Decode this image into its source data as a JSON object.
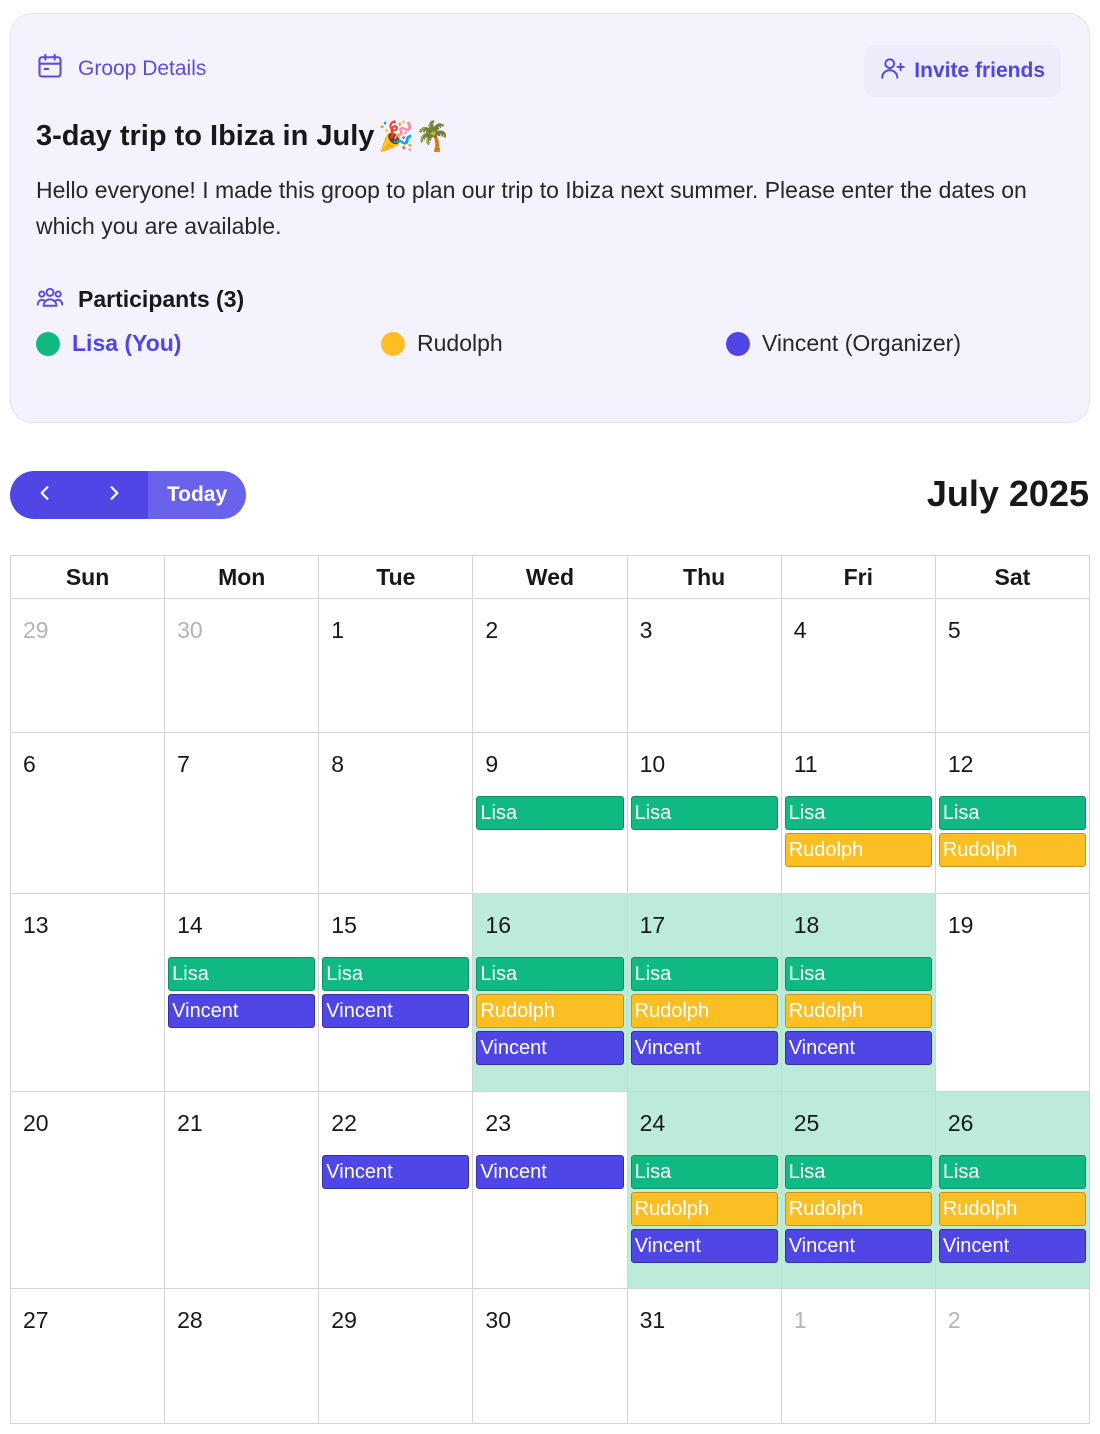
{
  "details": {
    "header_label": "Groop Details",
    "invite_label": "Invite friends",
    "title": "3-day trip to Ibiza in July",
    "title_emoji": "🎉🌴",
    "description": "Hello everyone! I made this groop to plan our trip to Ibiza next summer. Please enter the dates on which you are available.",
    "participants_label": "Participants (3)",
    "participants": [
      {
        "name": "Lisa (You)",
        "color": "#10b981"
      },
      {
        "name": "Rudolph",
        "color": "#fbbf24"
      },
      {
        "name": "Vincent (Organizer)",
        "color": "#4f46e5"
      }
    ]
  },
  "toolbar": {
    "prev_icon": "chevron-left-icon",
    "next_icon": "chevron-right-icon",
    "today_label": "Today",
    "month_title": "July 2025"
  },
  "colors": {
    "accent": "#4f46e5",
    "lisa": "#10b981",
    "rudolph": "#fbbf24",
    "vincent": "#4f46e5",
    "overlap_highlight": "#bcecd9"
  },
  "calendar": {
    "weekdays": [
      "Sun",
      "Mon",
      "Tue",
      "Wed",
      "Thu",
      "Fri",
      "Sat"
    ],
    "weeks": [
      [
        {
          "day": "29",
          "other": true,
          "events": []
        },
        {
          "day": "30",
          "other": true,
          "events": []
        },
        {
          "day": "1",
          "events": []
        },
        {
          "day": "2",
          "events": []
        },
        {
          "day": "3",
          "events": []
        },
        {
          "day": "4",
          "events": []
        },
        {
          "day": "5",
          "events": []
        }
      ],
      [
        {
          "day": "6",
          "events": []
        },
        {
          "day": "7",
          "events": []
        },
        {
          "day": "8",
          "events": []
        },
        {
          "day": "9",
          "events": [
            "Lisa"
          ]
        },
        {
          "day": "10",
          "events": [
            "Lisa"
          ]
        },
        {
          "day": "11",
          "events": [
            "Lisa",
            "Rudolph"
          ]
        },
        {
          "day": "12",
          "events": [
            "Lisa",
            "Rudolph"
          ]
        }
      ],
      [
        {
          "day": "13",
          "events": []
        },
        {
          "day": "14",
          "events": [
            "Lisa",
            "Vincent"
          ]
        },
        {
          "day": "15",
          "events": [
            "Lisa",
            "Vincent"
          ]
        },
        {
          "day": "16",
          "highlight": true,
          "events": [
            "Lisa",
            "Rudolph",
            "Vincent"
          ]
        },
        {
          "day": "17",
          "highlight": true,
          "events": [
            "Lisa",
            "Rudolph",
            "Vincent"
          ]
        },
        {
          "day": "18",
          "highlight": true,
          "events": [
            "Lisa",
            "Rudolph",
            "Vincent"
          ]
        },
        {
          "day": "19",
          "events": []
        }
      ],
      [
        {
          "day": "20",
          "events": []
        },
        {
          "day": "21",
          "events": []
        },
        {
          "day": "22",
          "events": [
            "Vincent"
          ]
        },
        {
          "day": "23",
          "events": [
            "Vincent"
          ]
        },
        {
          "day": "24",
          "highlight": true,
          "events": [
            "Lisa",
            "Rudolph",
            "Vincent"
          ]
        },
        {
          "day": "25",
          "highlight": true,
          "events": [
            "Lisa",
            "Rudolph",
            "Vincent"
          ]
        },
        {
          "day": "26",
          "highlight": true,
          "events": [
            "Lisa",
            "Rudolph",
            "Vincent"
          ]
        }
      ],
      [
        {
          "day": "27",
          "events": []
        },
        {
          "day": "28",
          "events": []
        },
        {
          "day": "29",
          "events": []
        },
        {
          "day": "30",
          "events": []
        },
        {
          "day": "31",
          "events": []
        },
        {
          "day": "1",
          "other": true,
          "events": []
        },
        {
          "day": "2",
          "other": true,
          "events": []
        }
      ]
    ]
  }
}
